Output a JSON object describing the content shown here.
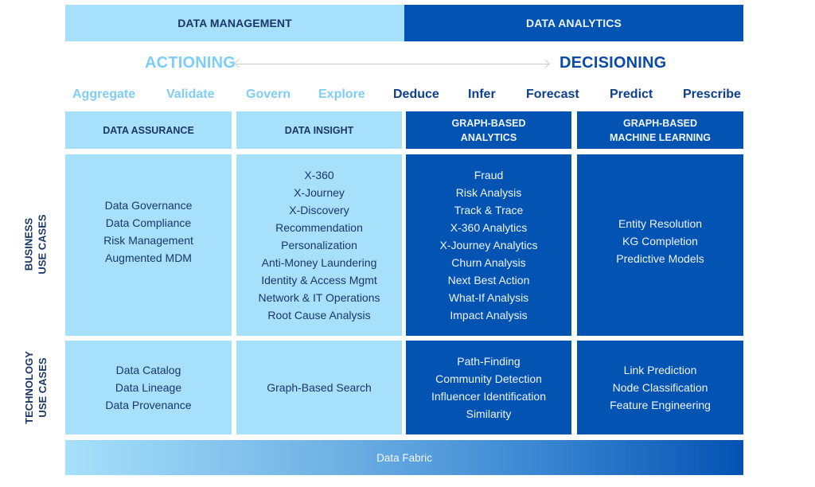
{
  "top_bar": {
    "left_label": "DATA MANAGEMENT",
    "right_label": "DATA ANALYTICS"
  },
  "axis": {
    "left_label": "ACTIONING",
    "right_label": "DECISIONING",
    "arrow_icon": "double-headed-arrow"
  },
  "verbs": [
    {
      "label": "Aggregate",
      "tone": "light"
    },
    {
      "label": "Validate",
      "tone": "light"
    },
    {
      "label": "Govern",
      "tone": "light"
    },
    {
      "label": "Explore",
      "tone": "light"
    },
    {
      "label": "Deduce",
      "tone": "dark"
    },
    {
      "label": "Infer",
      "tone": "dark"
    },
    {
      "label": "Forecast",
      "tone": "dark"
    },
    {
      "label": "Predict",
      "tone": "dark"
    },
    {
      "label": "Prescribe",
      "tone": "dark"
    }
  ],
  "columns": [
    {
      "header": [
        "DATA ASSURANCE"
      ]
    },
    {
      "header": [
        "DATA INSIGHT"
      ]
    },
    {
      "header": [
        "GRAPH-BASED",
        "ANALYTICS"
      ]
    },
    {
      "header": [
        "GRAPH-BASED",
        "MACHINE LEARNING"
      ]
    }
  ],
  "rows": {
    "business": {
      "label": [
        "BUSINESS",
        "USE CASES"
      ],
      "cells": [
        [
          "Data Governance",
          "Data Compliance",
          "Risk Management",
          "Augmented MDM"
        ],
        [
          "X-360",
          "X-Journey",
          "X-Discovery",
          "Recommendation",
          "Personalization",
          "Anti-Money Laundering",
          "Identity & Access Mgmt",
          "Network & IT Operations",
          "Root Cause Analysis"
        ],
        [
          "Fraud",
          "Risk Analysis",
          "Track & Trace",
          "X-360 Analytics",
          "X-Journey Analytics",
          "Churn Analysis",
          "Next Best Action",
          "What-If Analysis",
          "Impact Analysis"
        ],
        [
          "Entity Resolution",
          "KG Completion",
          "Predictive Models"
        ]
      ]
    },
    "technology": {
      "label": [
        "TECHNOLOGY",
        "USE CASES"
      ],
      "cells": [
        [
          "Data Catalog",
          "Data Lineage",
          "Data Provenance"
        ],
        [
          "Graph-Based Search"
        ],
        [
          "Path-Finding",
          "Community Detection",
          "Influencer Identification",
          "Similarity"
        ],
        [
          "Link Prediction",
          "Node Classification",
          "Feature Engineering"
        ]
      ]
    }
  },
  "footer": {
    "label": "Data Fabric"
  },
  "colors": {
    "light_blue": "#a7e0fb",
    "dark_blue": "#0353b3",
    "navy_text": "#1b3766",
    "actioning_text": "#7ccdf7",
    "decisioning_text": "#0b4aa6"
  }
}
